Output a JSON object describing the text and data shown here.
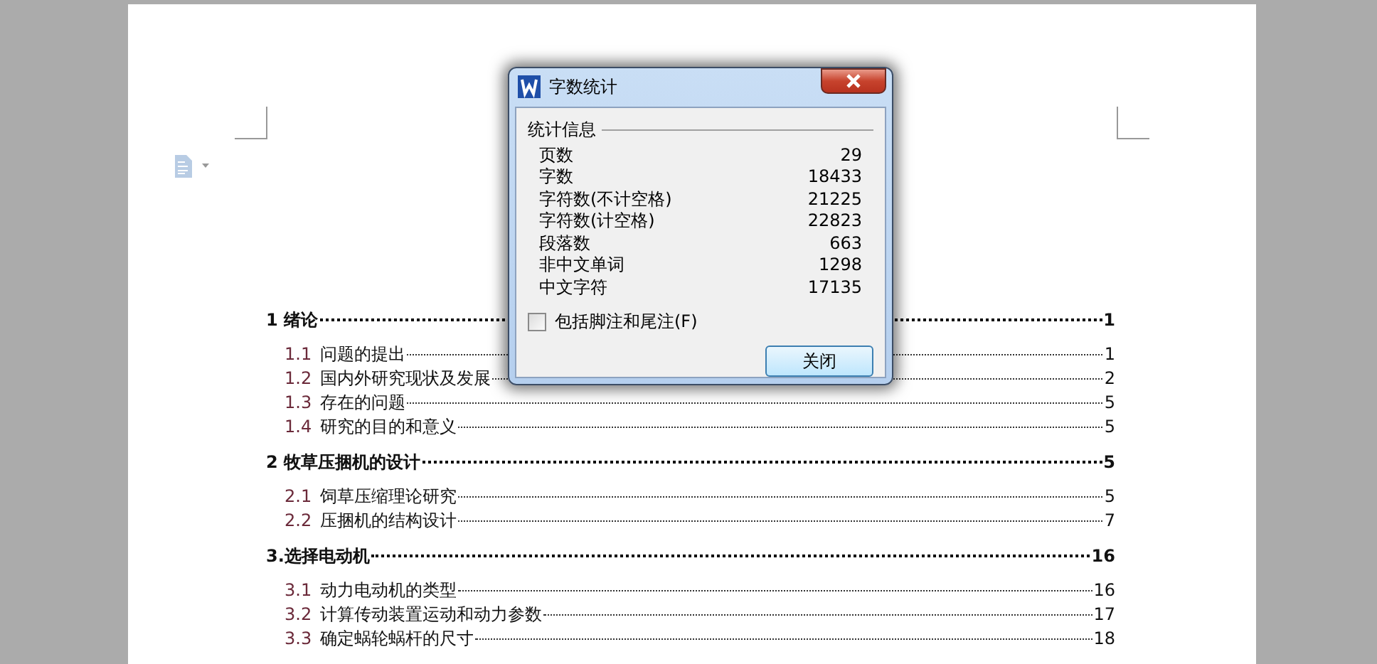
{
  "toc": [
    {
      "kind": "heading",
      "title": "1 绪论",
      "page": "1"
    },
    {
      "kind": "entry",
      "number": "1.1",
      "title": "问题的提出",
      "page": "1"
    },
    {
      "kind": "entry",
      "number": "1.2",
      "title": "国内外研究现状及发展",
      "page": "2"
    },
    {
      "kind": "entry",
      "number": "1.3",
      "title": "存在的问题",
      "page": "5"
    },
    {
      "kind": "entry",
      "number": "1.4",
      "title": "研究的目的和意义",
      "page": "5"
    },
    {
      "kind": "heading",
      "title": "2 牧草压捆机的设计",
      "page": "5"
    },
    {
      "kind": "entry",
      "number": "2.1",
      "title": "饲草压缩理论研究",
      "page": "5"
    },
    {
      "kind": "entry",
      "number": "2.2",
      "title": "压捆机的结构设计",
      "page": "7"
    },
    {
      "kind": "heading",
      "title": "3.选择电动机",
      "page": "16"
    },
    {
      "kind": "entry",
      "number": "3.1",
      "title": "动力电动机的类型",
      "page": "16"
    },
    {
      "kind": "entry",
      "number": "3.2",
      "title": "计算传动装置运动和动力参数",
      "page": "17"
    },
    {
      "kind": "entry",
      "number": "3.3",
      "title": "确定蜗轮蜗杆的尺寸",
      "page": "18"
    }
  ],
  "dialog": {
    "title": "字数统计",
    "group": "统计信息",
    "stats": [
      {
        "label": "页数",
        "value": "29"
      },
      {
        "label": "字数",
        "value": "18433"
      },
      {
        "label": "字符数(不计空格)",
        "value": "21225"
      },
      {
        "label": "字符数(计空格)",
        "value": "22823"
      },
      {
        "label": "段落数",
        "value": "663"
      },
      {
        "label": "非中文单词",
        "value": "1298"
      },
      {
        "label": "中文字符",
        "value": "17135"
      }
    ],
    "checkbox": {
      "label": "包括脚注和尾注(F)",
      "checked": false
    },
    "button": "关闭"
  }
}
